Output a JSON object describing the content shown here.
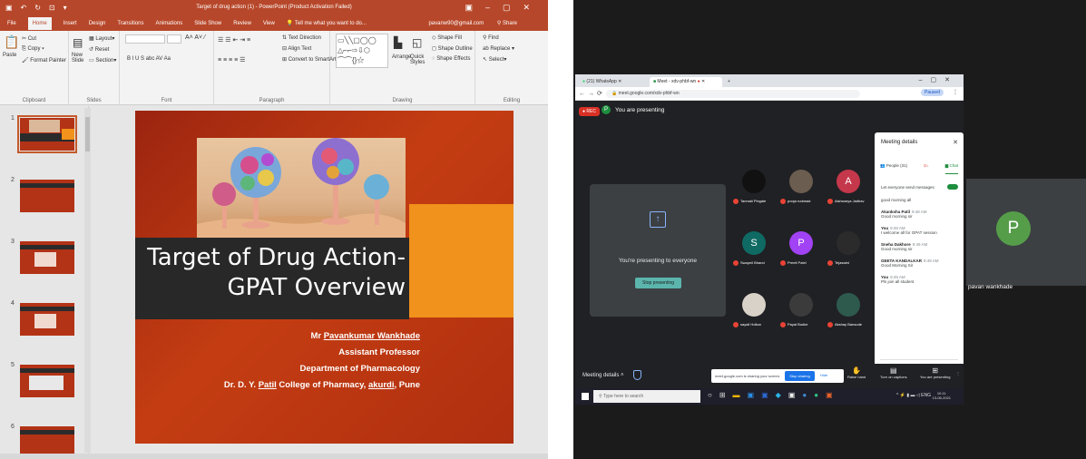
{
  "ppt": {
    "window_title": "Target of drug action (1) - PowerPoint (Product Activation Failed)",
    "tabs": [
      "File",
      "Home",
      "Insert",
      "Design",
      "Transitions",
      "Animations",
      "Slide Show",
      "Review",
      "View",
      "Tell me what you want to do..."
    ],
    "account": "pavanw90@gmail.com",
    "share": "Share",
    "ribbon": {
      "clipboard": {
        "paste": "Paste",
        "cut": "Cut",
        "copy": "Copy",
        "format_painter": "Format Painter",
        "label": "Clipboard"
      },
      "slides": {
        "new_slide": "New Slide",
        "layout": "Layout",
        "reset": "Reset",
        "section": "Section",
        "label": "Slides"
      },
      "font": {
        "label": "Font",
        "format_row": "B I U S abc AV Aa"
      },
      "paragraph": {
        "label": "Paragraph",
        "text_direction": "Text Direction",
        "align_text": "Align Text",
        "smartart": "Convert to SmartArt"
      },
      "drawing": {
        "label": "Drawing",
        "arrange": "Arrange",
        "quick_styles": "Quick Styles",
        "shape_fill": "Shape Fill",
        "shape_outline": "Shape Outline",
        "shape_effects": "Shape Effects"
      },
      "editing": {
        "label": "Editing",
        "find": "Find",
        "replace": "Replace",
        "select": "Select"
      }
    },
    "thumbnails": [
      "1",
      "2",
      "3",
      "4",
      "5",
      "6"
    ],
    "slide": {
      "title_line1": "Target of Drug Action-",
      "title_line2": "GPAT Overview",
      "author_prefix": "Mr ",
      "author_name": "Pavankumar Wankhade",
      "role": "Assistant Professor",
      "department": "Department of Pharmacology",
      "college_prefix": "Dr. D. Y. ",
      "college_patil": "Patil",
      "college_mid": " College of Pharmacy, ",
      "college_akurdi": "akurdi",
      "college_suffix": ", Pune"
    }
  },
  "meet": {
    "browser_tabs": [
      "(21) WhatsApp",
      "Meet - xdv-phbf-wn"
    ],
    "url": "meet.google.com/xdv-phbf-wn",
    "paused": "Paused",
    "rec": "REC",
    "presenting_avatar": "P",
    "presenting_label": "You are presenting",
    "present_message": "You're presenting to everyone",
    "stop_presenting": "Stop presenting",
    "participants": [
      {
        "name": "Tanmali Pingale",
        "initial": "",
        "color": "#111111"
      },
      {
        "name": "pooja rudrwad",
        "initial": "",
        "color": "#6b5d4f"
      },
      {
        "name": "Aishwarya Jadhav",
        "initial": "A",
        "color": "#c5374b"
      },
      {
        "name": "Swapnil Bhand",
        "initial": "S",
        "color": "#0f6a64"
      },
      {
        "name": "Preeti Patel",
        "initial": "P",
        "color": "#a142f4"
      },
      {
        "name": "Tejaswini",
        "initial": "",
        "color": "#2b2b2b"
      },
      {
        "name": "sayali Holkar",
        "initial": "",
        "color": "#d8d2c8"
      },
      {
        "name": "Payal Bodke",
        "initial": "",
        "color": "#3b3b3b"
      },
      {
        "name": "Akshay Bansode",
        "initial": "",
        "color": "#2e5a4e"
      }
    ],
    "panel": {
      "title": "Meeting details",
      "people": "People (31)",
      "chat": "Chat",
      "option": "Let everyone send messages",
      "messages": [
        {
          "author": "",
          "time": "",
          "text": "good morning all"
        },
        {
          "author": "Akanksha Patil",
          "time": "9:48 AM",
          "text": "Good morning sir"
        },
        {
          "author": "You",
          "time": "9:49 AM",
          "text": "I welcome all for GPAT session"
        },
        {
          "author": "Sneha Dakhore",
          "time": "9:49 AM",
          "text": "Good morning sir"
        },
        {
          "author": "GEETA KANDALKAR",
          "time": "9:49 AM",
          "text": "Good Morning Sir"
        },
        {
          "author": "You",
          "time": "9:49 AM",
          "text": "Pls join all student"
        }
      ],
      "input_placeholder": "Send a message to everyone"
    },
    "bottom": {
      "meeting_details": "Meeting details",
      "share_msg": "meet.google.com is sharing your screen.",
      "stop_sharing": "Stop sharing",
      "hide": "Hide",
      "raise_hand": "Raise hand",
      "captions": "Turn on captions",
      "presenting": "You are presenting"
    },
    "taskbar": {
      "search": "Type here to search",
      "time": "10:11",
      "date": "13-06-2021"
    },
    "big_tile": {
      "initial": "P",
      "name": "pavan wankhade",
      "color": "#569d4a"
    }
  }
}
